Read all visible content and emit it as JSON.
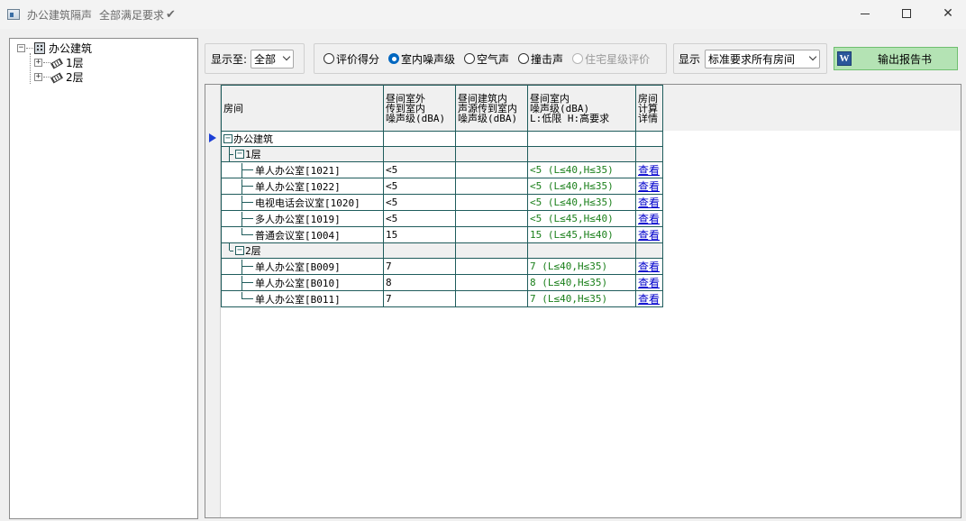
{
  "window": {
    "title": "办公建筑隔声",
    "status": "全部满足要求",
    "status_icon": "check-icon"
  },
  "tree": {
    "root": "办公建筑",
    "children": [
      "1层",
      "2层"
    ]
  },
  "toolbar": {
    "show_to_label": "显示至:",
    "show_to_value": "全部",
    "radios": [
      {
        "label": "评价得分",
        "checked": false,
        "disabled": false
      },
      {
        "label": "室内噪声级",
        "checked": true,
        "disabled": false
      },
      {
        "label": "空气声",
        "checked": false,
        "disabled": false
      },
      {
        "label": "撞击声",
        "checked": false,
        "disabled": false
      },
      {
        "label": "住宅星级评价",
        "checked": false,
        "disabled": true
      }
    ],
    "display_label": "显示",
    "display_value": "标准要求所有房间",
    "report_button": "输出报告书"
  },
  "grid": {
    "headers": {
      "room": "房间",
      "col1": [
        "昼间室外",
        "传到室内",
        "噪声级(dBA)"
      ],
      "col2": [
        "昼间建筑内",
        "声源传到室内",
        "噪声级(dBA)"
      ],
      "col3": [
        "昼间室内",
        "噪声级(dBA)",
        "L:低限 H:高要求"
      ],
      "col4": [
        "房间",
        "计算",
        "详情"
      ]
    },
    "building": "办公建筑",
    "floors": [
      {
        "name": "1层",
        "rooms": [
          {
            "name": "单人办公室[1021]",
            "outdoor": "<5",
            "indoor_src": "",
            "result": "<5 (L≤40,H≤35)",
            "detail": "查看"
          },
          {
            "name": "单人办公室[1022]",
            "outdoor": "<5",
            "indoor_src": "",
            "result": "<5 (L≤40,H≤35)",
            "detail": "查看"
          },
          {
            "name": "电视电话会议室[1020]",
            "outdoor": "<5",
            "indoor_src": "",
            "result": "<5 (L≤40,H≤35)",
            "detail": "查看"
          },
          {
            "name": "多人办公室[1019]",
            "outdoor": "<5",
            "indoor_src": "",
            "result": "<5 (L≤45,H≤40)",
            "detail": "查看"
          },
          {
            "name": "普通会议室[1004]",
            "outdoor": "15",
            "indoor_src": "",
            "result": "15 (L≤45,H≤40)",
            "detail": "查看"
          }
        ]
      },
      {
        "name": "2层",
        "rooms": [
          {
            "name": "单人办公室[B009]",
            "outdoor": "7",
            "indoor_src": "",
            "result": "7 (L≤40,H≤35)",
            "detail": "查看"
          },
          {
            "name": "单人办公室[B010]",
            "outdoor": "8",
            "indoor_src": "",
            "result": "8 (L≤40,H≤35)",
            "detail": "查看"
          },
          {
            "name": "单人办公室[B011]",
            "outdoor": "7",
            "indoor_src": "",
            "result": "7 (L≤40,H≤35)",
            "detail": "查看"
          }
        ]
      }
    ]
  }
}
